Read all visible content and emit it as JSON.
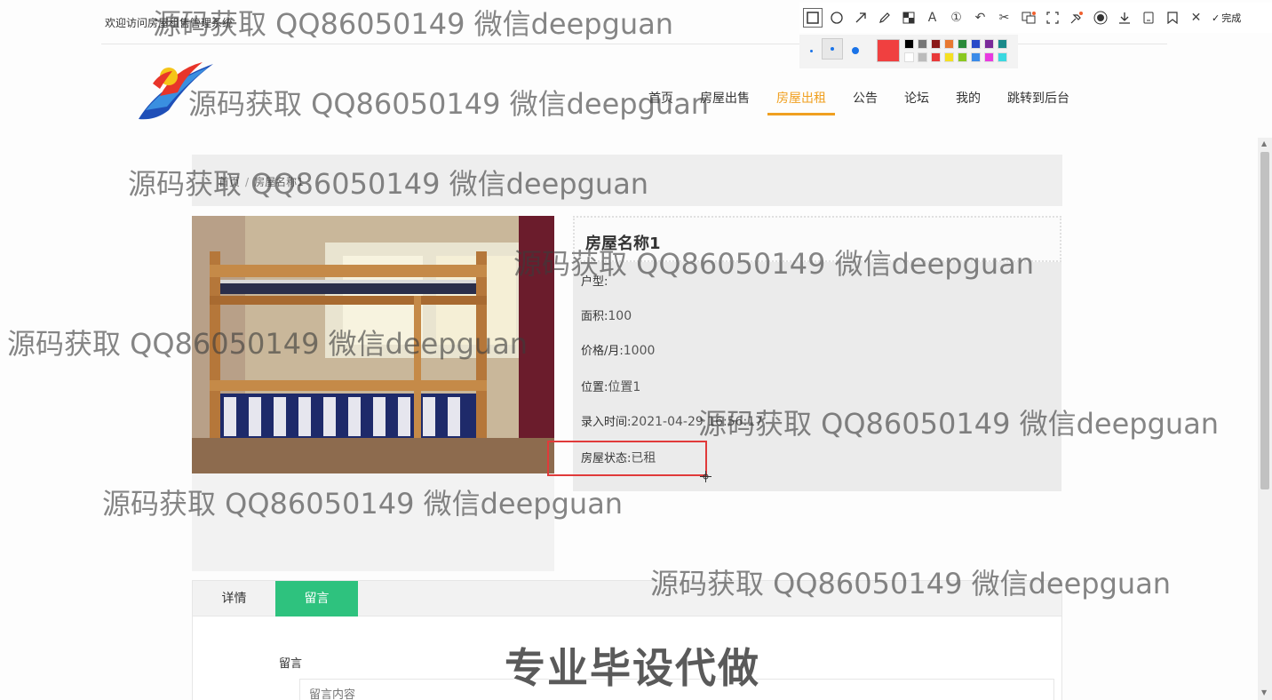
{
  "header": {
    "welcome": "欢迎访问房屋租售管理系统"
  },
  "nav": {
    "items": [
      "首页",
      "房屋出售",
      "房屋出租",
      "公告",
      "论坛",
      "我的",
      "跳转到后台"
    ],
    "active": "房屋出租"
  },
  "breadcrumb": {
    "home": "首页",
    "current": "房屋名称1"
  },
  "house": {
    "title": "房屋名称1",
    "type_label": "户型:",
    "type_value": "",
    "area_label": "面积:",
    "area_value": "100",
    "price_label": "价格/月:",
    "price_value": "1000",
    "location_label": "位置:",
    "location_value": "位置1",
    "time_label": "录入时间:",
    "time_value": "2021-04-29 16:56:17",
    "status_label": "房屋状态:",
    "status_value": "已租"
  },
  "tabs": {
    "detail": "详情",
    "comment": "留言",
    "active": "留言"
  },
  "comment_form": {
    "label": "留言",
    "placeholder": "留言内容"
  },
  "toolbar": {
    "done_label": "完成"
  },
  "watermark": "源码获取 QQ86050149 微信deepguan",
  "banner": "专业毕设代做",
  "colors": {
    "accent": "#f0a020",
    "tab_active": "#2ec27e",
    "highlight": "#e03a3a",
    "current_color": "#f04040"
  }
}
